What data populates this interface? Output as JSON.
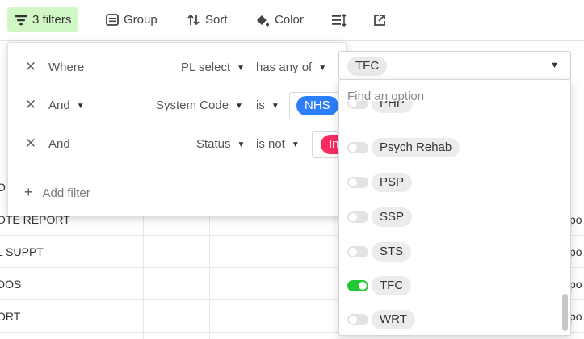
{
  "toolbar": {
    "filters_label": "3 filters",
    "group_label": "Group",
    "sort_label": "Sort",
    "color_label": "Color",
    "accent_color": "#d1f7c4"
  },
  "table": {
    "rows": [
      "O",
      "OTE REPORT",
      "L SUPPT",
      "DOS",
      "ORT"
    ],
    "right_fragments": [
      "po",
      "po",
      "po",
      "po"
    ]
  },
  "filters": [
    {
      "conjunction": "Where",
      "field": "PL select",
      "operator": "has any of",
      "value": "TFC"
    },
    {
      "conjunction": "And",
      "field": "System Code",
      "operator": "is",
      "value": "NHS",
      "value_color": "#2d7ff9"
    },
    {
      "conjunction": "And",
      "field": "Status",
      "operator": "is not",
      "value": "In",
      "value_color": "#f82b60"
    }
  ],
  "add_filter_label": "Add filter",
  "dropdown": {
    "search_placeholder": "Find an option",
    "options": [
      {
        "label": "PHP",
        "checked": false
      },
      {
        "label": "Psych Rehab",
        "checked": false
      },
      {
        "label": "PSP",
        "checked": false
      },
      {
        "label": "SSP",
        "checked": false
      },
      {
        "label": "STS",
        "checked": false
      },
      {
        "label": "TFC",
        "checked": true
      },
      {
        "label": "WRT",
        "checked": false
      }
    ],
    "on_color": "#20c933"
  }
}
